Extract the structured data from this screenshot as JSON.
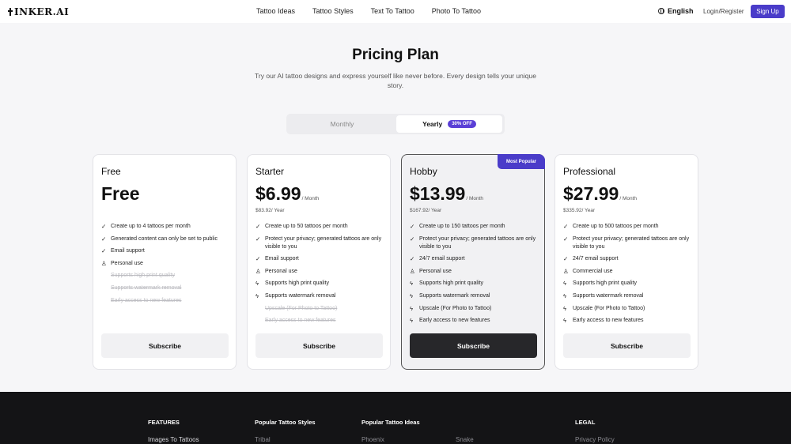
{
  "header": {
    "logo": "INKER.AI",
    "nav": [
      "Tattoo Ideas",
      "Tattoo Styles",
      "Text To Tattoo",
      "Photo To Tattoo"
    ],
    "language": "English",
    "login": "Login/Register",
    "signup": "Sign Up"
  },
  "hero": {
    "title": "Pricing Plan",
    "subtitle": "Try our AI tattoo designs and express yourself like never before. Every design tells your unique story."
  },
  "billing_toggle": {
    "monthly": "Monthly",
    "yearly": "Yearly",
    "yearly_badge": "30% OFF",
    "selected": "Yearly"
  },
  "plans": [
    {
      "name": "Free",
      "price": "Free",
      "per": "",
      "yearly": "",
      "features": [
        {
          "icon": "check-icon",
          "text": "Create up to 4 tattoos per month",
          "enabled": true
        },
        {
          "icon": "check-icon",
          "text": "Generated content can only be set to public",
          "enabled": true
        },
        {
          "icon": "check-icon",
          "text": "Email support",
          "enabled": true
        },
        {
          "icon": "user-icon",
          "text": "Personal use",
          "enabled": true
        },
        {
          "icon": "",
          "text": "Supports high print quality",
          "enabled": false
        },
        {
          "icon": "",
          "text": "Supports watermark removal",
          "enabled": false
        },
        {
          "icon": "",
          "text": "Early access to new features",
          "enabled": false
        }
      ],
      "button": "Subscribe"
    },
    {
      "name": "Starter",
      "price": "$6.99",
      "per": "/ Month",
      "yearly": "$83.92/ Year",
      "features": [
        {
          "icon": "check-icon",
          "text": "Create up to 50 tattoos per month",
          "enabled": true
        },
        {
          "icon": "check-icon",
          "text": "Protect your privacy; generated tattoos are only visible to you",
          "enabled": true
        },
        {
          "icon": "check-icon",
          "text": "Email support",
          "enabled": true
        },
        {
          "icon": "user-icon",
          "text": "Personal use",
          "enabled": true
        },
        {
          "icon": "bolt-icon",
          "text": "Supports high print quality",
          "enabled": true
        },
        {
          "icon": "bolt-icon",
          "text": "Supports watermark removal",
          "enabled": true
        },
        {
          "icon": "",
          "text": "Upscale (For Photo to Tattoo)",
          "enabled": false
        },
        {
          "icon": "",
          "text": "Early access to new features",
          "enabled": false
        }
      ],
      "button": "Subscribe"
    },
    {
      "name": "Hobby",
      "price": "$13.99",
      "per": "/ Month",
      "yearly": "$167.92/ Year",
      "tag": "Most Popular",
      "features": [
        {
          "icon": "check-icon",
          "text": "Create up to 150 tattoos per month",
          "enabled": true
        },
        {
          "icon": "check-icon",
          "text": "Protect your privacy; generated tattoos are only visible to you",
          "enabled": true
        },
        {
          "icon": "check-icon",
          "text": "24/7 email support",
          "enabled": true
        },
        {
          "icon": "user-icon",
          "text": "Personal use",
          "enabled": true
        },
        {
          "icon": "bolt-icon",
          "text": "Supports high print quality",
          "enabled": true
        },
        {
          "icon": "bolt-icon",
          "text": "Supports watermark removal",
          "enabled": true
        },
        {
          "icon": "bolt-icon",
          "text": "Upscale (For Photo to Tattoo)",
          "enabled": true
        },
        {
          "icon": "bolt-icon",
          "text": "Early access to new features",
          "enabled": true
        }
      ],
      "button": "Subscribe"
    },
    {
      "name": "Professional",
      "price": "$27.99",
      "per": "/ Month",
      "yearly": "$335.92/ Year",
      "features": [
        {
          "icon": "check-icon",
          "text": "Create up to 500 tattoos per month",
          "enabled": true
        },
        {
          "icon": "check-icon",
          "text": "Protect your privacy; generated tattoos are only visible to you",
          "enabled": true
        },
        {
          "icon": "check-icon",
          "text": "24/7 email support",
          "enabled": true
        },
        {
          "icon": "users-icon",
          "text": "Commercial use",
          "enabled": true
        },
        {
          "icon": "bolt-icon",
          "text": "Supports high print quality",
          "enabled": true
        },
        {
          "icon": "bolt-icon",
          "text": "Supports watermark removal",
          "enabled": true
        },
        {
          "icon": "bolt-icon",
          "text": "Upscale (For Photo to Tattoo)",
          "enabled": true
        },
        {
          "icon": "bolt-icon",
          "text": "Early access to new features",
          "enabled": true
        }
      ],
      "button": "Subscribe"
    }
  ],
  "footer": {
    "features_head": "FEATURES",
    "features_link": "Images To Tattoos",
    "styles_head": "Popular Tattoo Styles",
    "styles_link": "Tribal",
    "ideas_head": "Popular Tattoo Ideas",
    "ideas_link1": "Phoenix",
    "ideas_link2": "Snake",
    "legal_head": "LEGAL",
    "legal_link": "Privacy Policy"
  },
  "colors": {
    "accent": "#4a3cc9",
    "dark_button": "#27272a",
    "footer_bg": "#141416"
  }
}
